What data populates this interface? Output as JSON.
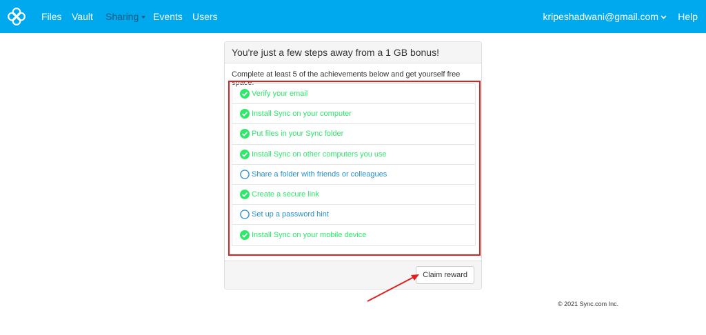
{
  "nav": {
    "links": [
      "Files",
      "Vault",
      "Sharing",
      "Events",
      "Users"
    ],
    "account": "kripeshadwani@gmail.com",
    "help": "Help"
  },
  "panel": {
    "heading": "You're just a few steps away from a 1 GB bonus!",
    "description": "Complete at least 5 of the achievements below and get yourself free space.",
    "items": [
      {
        "label": "Verify your email",
        "done": true
      },
      {
        "label": "Install Sync on your computer",
        "done": true
      },
      {
        "label": "Put files in your Sync folder",
        "done": true
      },
      {
        "label": "Install Sync on other computers you use",
        "done": true
      },
      {
        "label": "Share a folder with friends or colleagues",
        "done": false
      },
      {
        "label": "Create a secure link",
        "done": true
      },
      {
        "label": "Set up a password hint",
        "done": false
      },
      {
        "label": "Install Sync on your mobile device",
        "done": true
      }
    ],
    "claim_button": "Claim reward"
  },
  "footer": {
    "copyright": "© 2021 Sync.com Inc."
  },
  "colors": {
    "nav": "#00a8ee",
    "done": "#2ee86a",
    "todo": "#2a90c9",
    "highlight": "#e02020"
  }
}
